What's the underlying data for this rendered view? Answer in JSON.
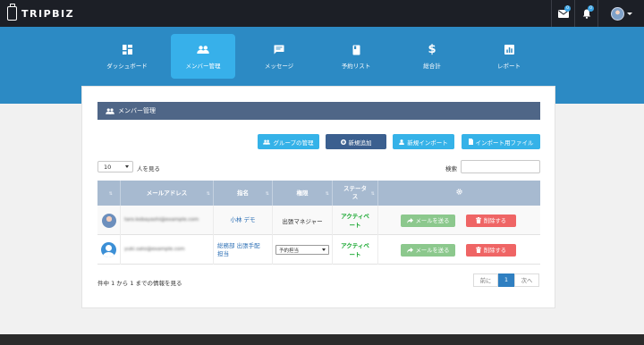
{
  "app": {
    "logo_text": "TRIPBIZ"
  },
  "topbar": {
    "mail_badge": "0",
    "bell_badge": "0"
  },
  "nav": [
    {
      "label": "ダッシュボード",
      "icon": "dashboard-icon"
    },
    {
      "label": "メンバー管理",
      "icon": "users-icon",
      "active": true
    },
    {
      "label": "メッセージ",
      "icon": "message-icon"
    },
    {
      "label": "予約リスト",
      "icon": "book-icon"
    },
    {
      "label": "総合計",
      "icon": "dollar-icon"
    },
    {
      "label": "レポート",
      "icon": "report-icon"
    }
  ],
  "card": {
    "title": "メンバー管理",
    "buttons": {
      "group": "グループの管理",
      "add": "新規追加",
      "import": "新規インポート",
      "import_file": "インポート用ファイル"
    }
  },
  "table_controls": {
    "page_length": "10",
    "page_length_suffix": "人を見る",
    "search_label": "検索"
  },
  "table": {
    "headers": [
      "",
      "メールアドレス",
      "指名",
      "権限",
      "ステータス",
      ""
    ],
    "rows": [
      {
        "email": "taro.kobayashi@example.com",
        "name": "小林 デモ",
        "role": "出張マネジャー",
        "role_is_select": false,
        "status": "アクティベート",
        "send_mail": "メールを送る",
        "delete": "削除する"
      },
      {
        "email": "yuki.sato@example.com",
        "name": "総務部 出張手配担当",
        "role": "予約担当",
        "role_is_select": true,
        "status": "アクティベート",
        "send_mail": "メールを送る",
        "delete": "削除する"
      }
    ]
  },
  "footer_info": "件中 1 から 1 までの情報を見る",
  "pagination": {
    "prev": "前に",
    "current": "1",
    "next": "次へ"
  },
  "colors": {
    "topbar": "#1c1f26",
    "band": "#2c8ac4",
    "nav_active": "#37b0ea",
    "card_header": "#4f6687",
    "status_green": "#11a52a",
    "send_green": "#8cc88d",
    "delete_red": "#ef6565"
  }
}
